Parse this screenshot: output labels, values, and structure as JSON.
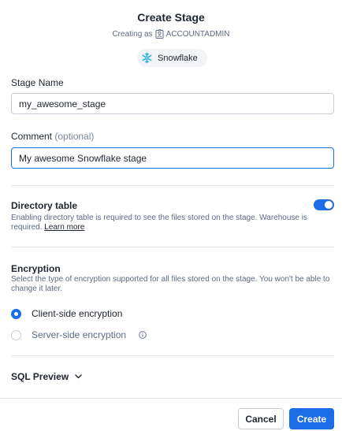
{
  "header": {
    "title": "Create Stage",
    "creating_as_prefix": "Creating as",
    "role": "ACCOUNTADMIN",
    "provider": "Snowflake"
  },
  "stage_name": {
    "label": "Stage Name",
    "value": "my_awesome_stage"
  },
  "comment": {
    "label": "Comment",
    "optional": "(optional)",
    "value": "My awesome Snowflake stage"
  },
  "directory_table": {
    "title": "Directory table",
    "description": "Enabling directory table is required to see the files stored on the stage. Warehouse is required.",
    "learn_more": "Learn more",
    "enabled": true
  },
  "encryption": {
    "title": "Encryption",
    "description": "Select the type of encryption supported for all files stored on the stage. You won't be able to change it later.",
    "options": [
      {
        "label": "Client-side encryption",
        "selected": true
      },
      {
        "label": "Server-side encryption",
        "selected": false
      }
    ]
  },
  "sql_preview": {
    "label": "SQL Preview"
  },
  "footer": {
    "cancel_label": "Cancel",
    "create_label": "Create"
  },
  "colors": {
    "accent": "#1a6ce7",
    "snowflake": "#29b5e8"
  },
  "icons": {
    "role": "role-person-icon",
    "provider": "snowflake-icon",
    "info": "info-icon",
    "chevron": "chevron-down-icon"
  }
}
